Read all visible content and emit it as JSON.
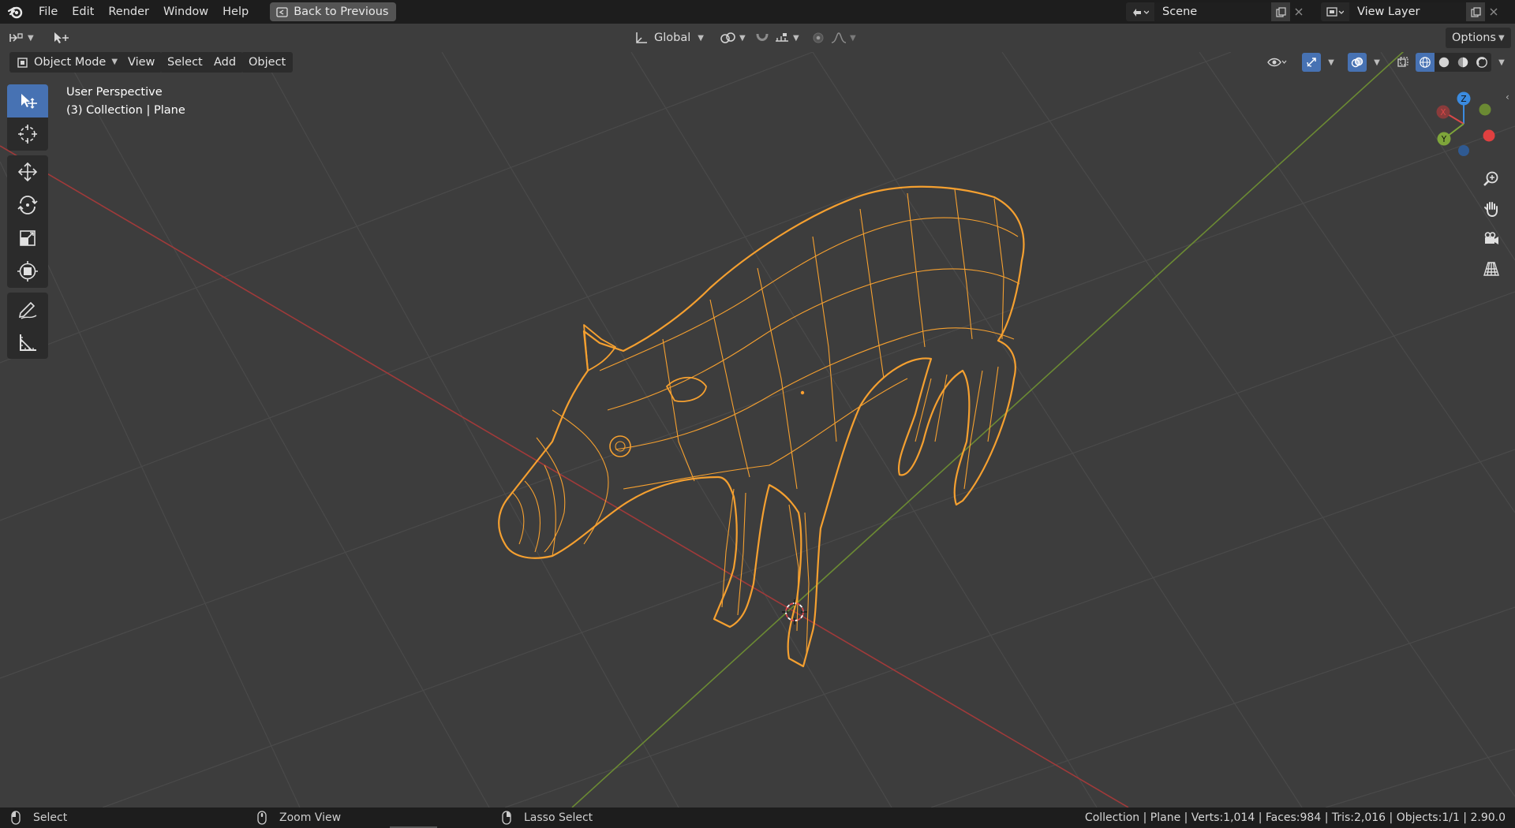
{
  "menubar": {
    "items": [
      "File",
      "Edit",
      "Render",
      "Window",
      "Help"
    ],
    "back_button": "Back to Previous",
    "scene_name": "Scene",
    "view_layer_name": "View Layer"
  },
  "toolheader": {
    "orientation": "Global",
    "options": "Options"
  },
  "mode_row": {
    "mode": "Object Mode",
    "menus": [
      "View",
      "Select",
      "Add",
      "Object"
    ]
  },
  "viewport": {
    "view_name": "User Perspective",
    "collection_info": "(3) Collection | Plane",
    "gizmo_axes": [
      "X",
      "Y",
      "Z"
    ]
  },
  "toolbar": {
    "tools": [
      "select-box",
      "cursor",
      "move",
      "rotate",
      "scale",
      "transform",
      "annotate",
      "measure"
    ],
    "active": "select-box"
  },
  "navigation": [
    "zoom",
    "pan",
    "camera",
    "orthographic"
  ],
  "statusbar": {
    "hint_left": "Select",
    "hint_mid": "Zoom View",
    "hint_right": "Lasso Select",
    "stats": "Collection | Plane | Verts:1,014 | Faces:984 | Tris:2,016 | Objects:1/1 | 2.90.0"
  },
  "colors": {
    "accent": "#4772b3",
    "selection": "#f5a030",
    "x_axis": "#d94848",
    "y_axis": "#7ea53a",
    "z_axis": "#3b8be0"
  }
}
